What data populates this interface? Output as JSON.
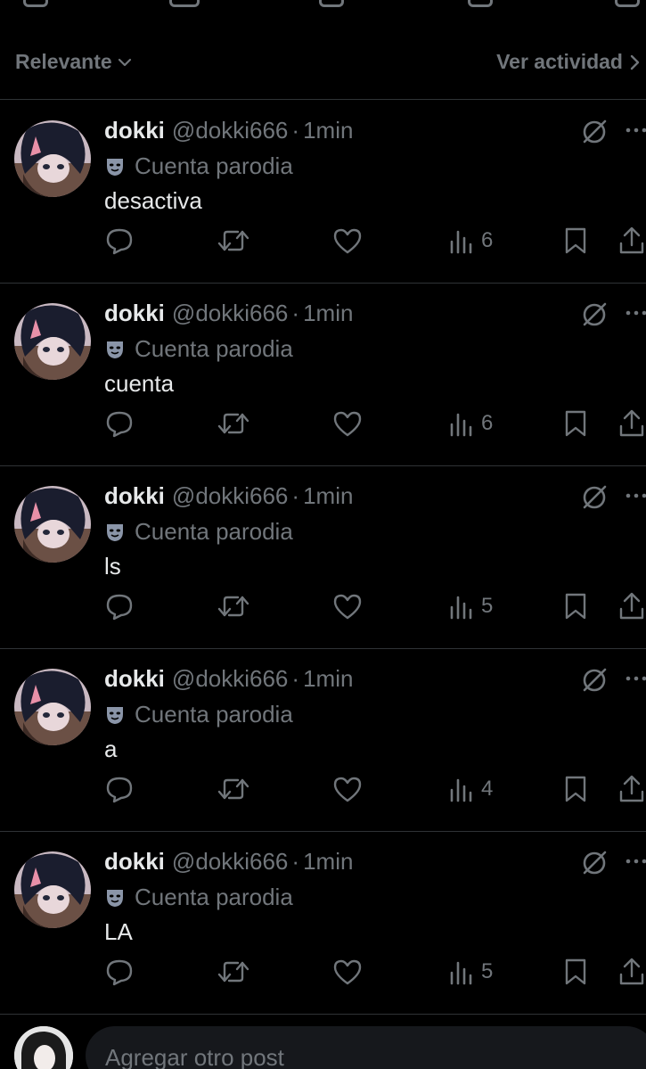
{
  "filter": {
    "sort_label": "Relevante",
    "activity_label": "Ver actividad"
  },
  "posts": [
    {
      "name": "dokki",
      "handle": "@dokki666",
      "dot": "·",
      "time": "1min",
      "badge": "Cuenta parodia",
      "text": "desactiva",
      "views": "6"
    },
    {
      "name": "dokki",
      "handle": "@dokki666",
      "dot": "·",
      "time": "1min",
      "badge": "Cuenta parodia",
      "text": "cuenta",
      "views": "6"
    },
    {
      "name": "dokki",
      "handle": "@dokki666",
      "dot": "·",
      "time": "1min",
      "badge": "Cuenta parodia",
      "text": "ls",
      "views": "5"
    },
    {
      "name": "dokki",
      "handle": "@dokki666",
      "dot": "·",
      "time": "1min",
      "badge": "Cuenta parodia",
      "text": "a",
      "views": "4"
    },
    {
      "name": "dokki",
      "handle": "@dokki666",
      "dot": "·",
      "time": "1min",
      "badge": "Cuenta parodia",
      "text": "LA",
      "views": "5"
    }
  ],
  "composer": {
    "placeholder": "Agregar otro post"
  },
  "icons": {
    "reply": "reply-icon",
    "repost": "repost-icon",
    "like": "like-icon",
    "views": "views-icon",
    "bookmark": "bookmark-icon",
    "share": "share-icon",
    "grok": "grok-icon",
    "more": "more-icon",
    "parody": "parody-mask-icon"
  },
  "colors": {
    "background": "#000000",
    "text": "#e7e9ea",
    "muted": "#71767b",
    "divider": "#2f3336",
    "input_bg": "#16181c",
    "badge_mask": "#8a95a8"
  }
}
